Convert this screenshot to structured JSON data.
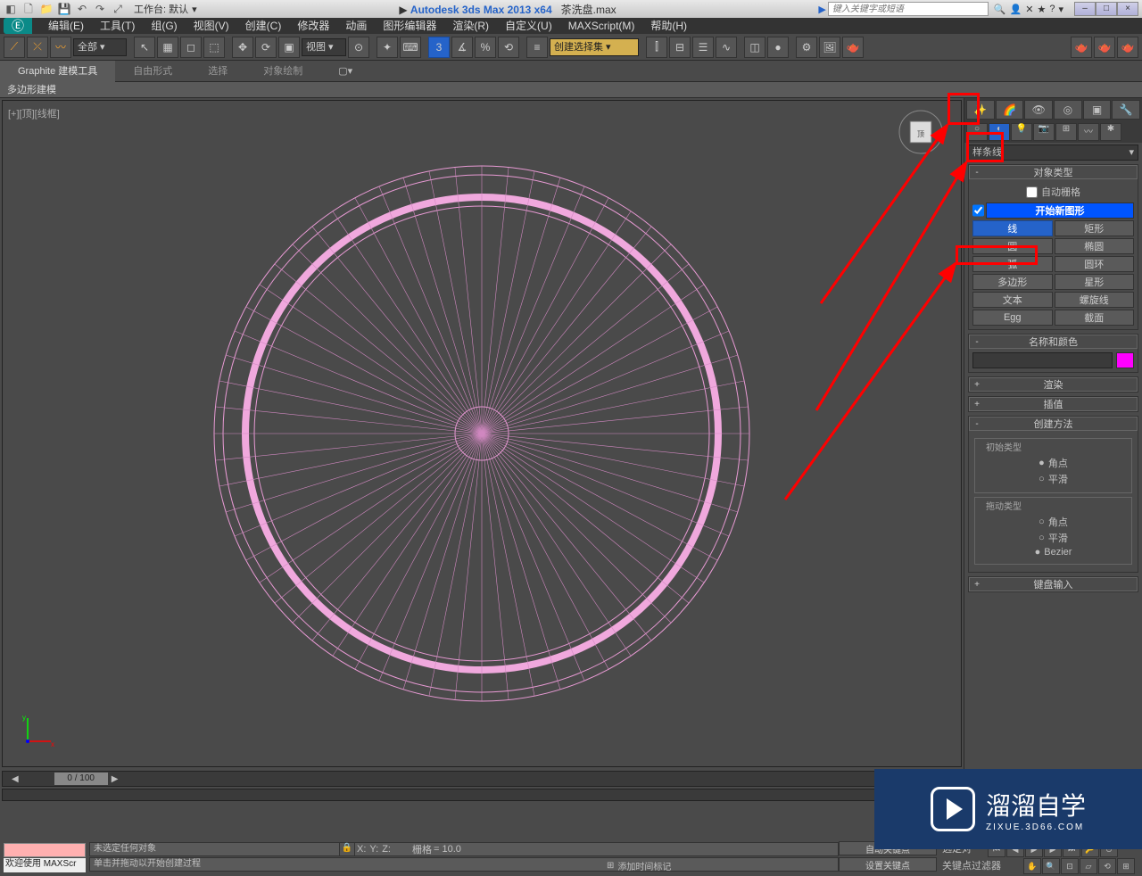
{
  "title": {
    "app": "Autodesk 3ds Max  2013 x64",
    "file": "茶洗盘.max",
    "workspace_label": "工作台: 默认",
    "search_placeholder": "键入关键字或短语"
  },
  "winbtns": {
    "min": "–",
    "max": "□",
    "close": "×"
  },
  "menu": [
    "编辑(E)",
    "工具(T)",
    "组(G)",
    "视图(V)",
    "创建(C)",
    "修改器",
    "动画",
    "图形编辑器",
    "渲染(R)",
    "自定义(U)",
    "MAXScript(M)",
    "帮助(H)"
  ],
  "toolbar": {
    "all_filter": "全部",
    "view_dd": "视图",
    "selset_placeholder": "创建选择集"
  },
  "ribbon": {
    "tabs": [
      "Graphite 建模工具",
      "自由形式",
      "选择",
      "对象绘制"
    ],
    "sub": "多边形建模"
  },
  "viewport": {
    "label": "[+][顶][线框]"
  },
  "panel": {
    "dropdown": "样条线",
    "object_type": {
      "title": "对象类型",
      "autogrid": "自动栅格",
      "start_new": "开始新图形",
      "buttons": [
        [
          "线",
          "矩形"
        ],
        [
          "圆",
          "椭圆"
        ],
        [
          "弧",
          "圆环"
        ],
        [
          "多边形",
          "星形"
        ],
        [
          "文本",
          "螺旋线"
        ],
        [
          "Egg",
          "截面"
        ]
      ]
    },
    "name_color": {
      "title": "名称和颜色"
    },
    "render": "渲染",
    "interp": "插值",
    "create_method": {
      "title": "创建方法",
      "initial_title": "初始类型",
      "initial_opts": [
        "角点",
        "平滑"
      ],
      "drag_title": "拖动类型",
      "drag_opts": [
        "角点",
        "平滑",
        "Bezier"
      ]
    },
    "keyboard": "键盘输入"
  },
  "timeline": {
    "pos": "0 / 100"
  },
  "status": {
    "noselect": "未选定任何对象",
    "prompt": "单击并拖动以开始创建过程",
    "welcome": "欢迎使用  MAXScr",
    "grid_label": "栅格",
    "grid_val": "= 10.0",
    "autokey": "自动关键点",
    "setkey": "设置关键点",
    "selset": "选定对",
    "keyfilter": "关键点过滤器",
    "addtime": "添加时间标记",
    "x": "X:",
    "y": "Y:",
    "z": "Z:"
  },
  "watermark": {
    "brand": "溜溜自学",
    "url": "ZIXUE.3D66.COM"
  }
}
